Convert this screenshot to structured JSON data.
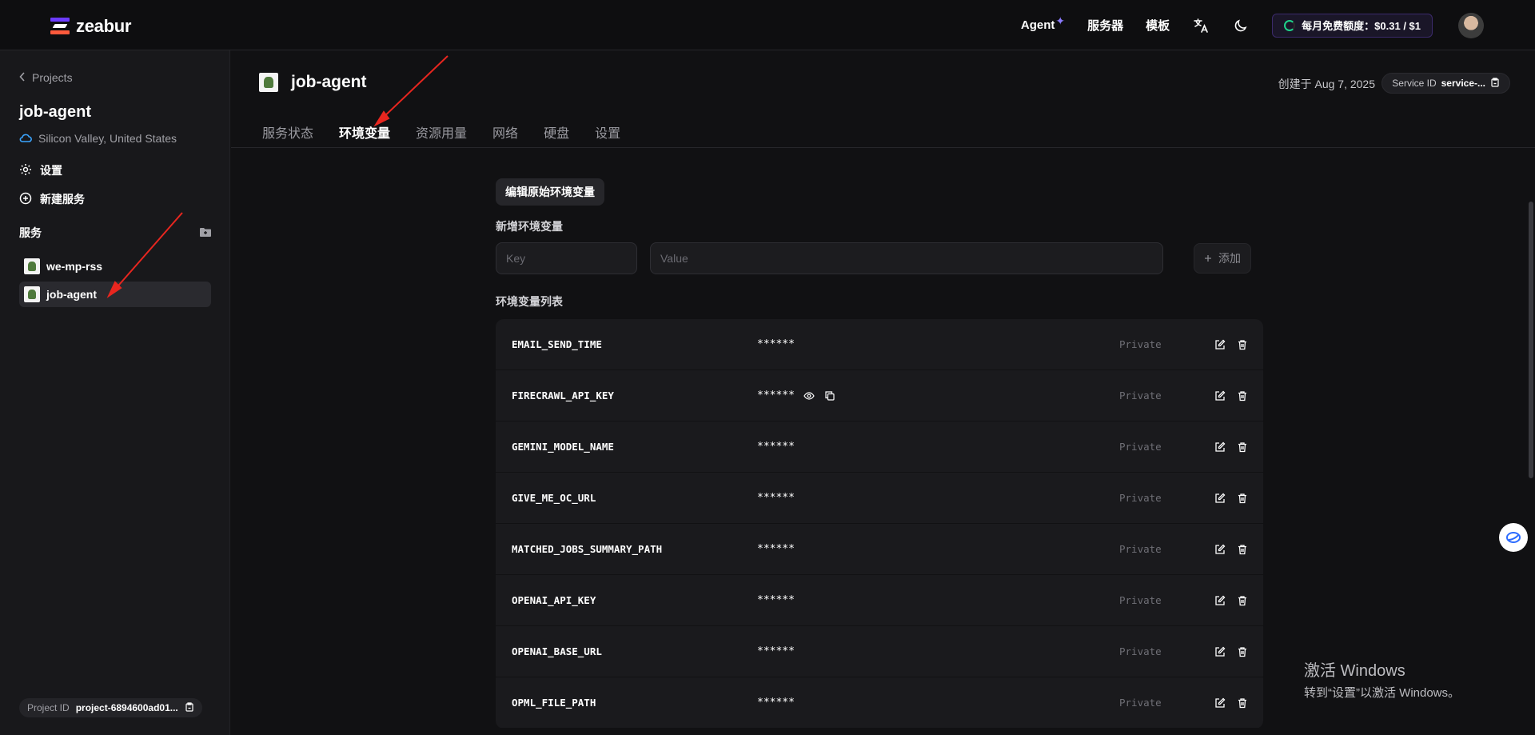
{
  "header": {
    "logo": "zeabur",
    "nav": {
      "agent": "Agent",
      "servers": "服务器",
      "templates": "模板"
    },
    "quota": "每月免费额度：$0.31 / $1"
  },
  "sidebar": {
    "back": "Projects",
    "project_name": "job-agent",
    "region": "Silicon Valley, United States",
    "settings": "设置",
    "new_service": "新建服务",
    "services_heading": "服务",
    "services": [
      {
        "name": "we-mp-rss"
      },
      {
        "name": "job-agent"
      }
    ],
    "project_id_label": "Project ID",
    "project_id": "project-6894600ad01..."
  },
  "service": {
    "name": "job-agent",
    "created": "创建于 Aug 7, 2025",
    "service_id_label": "Service ID",
    "service_id": "service-..."
  },
  "tabs": [
    "服务状态",
    "环境变量",
    "资源用量",
    "网络",
    "硬盘",
    "设置"
  ],
  "env": {
    "edit_raw": "编辑原始环境变量",
    "new_label": "新增环境变量",
    "key_placeholder": "Key",
    "value_placeholder": "Value",
    "add": "添加",
    "list_label": "环境变量列表",
    "rows": [
      {
        "key": "EMAIL_SEND_TIME",
        "value": "******",
        "visibility": "Private"
      },
      {
        "key": "FIRECRAWL_API_KEY",
        "value": "******",
        "visibility": "Private"
      },
      {
        "key": "GEMINI_MODEL_NAME",
        "value": "******",
        "visibility": "Private"
      },
      {
        "key": "GIVE_ME_OC_URL",
        "value": "******",
        "visibility": "Private"
      },
      {
        "key": "MATCHED_JOBS_SUMMARY_PATH",
        "value": "******",
        "visibility": "Private"
      },
      {
        "key": "OPENAI_API_KEY",
        "value": "******",
        "visibility": "Private"
      },
      {
        "key": "OPENAI_BASE_URL",
        "value": "******",
        "visibility": "Private"
      },
      {
        "key": "OPML_FILE_PATH",
        "value": "******",
        "visibility": "Private"
      }
    ]
  },
  "watermark": {
    "line1": "激活 Windows",
    "line2": "转到“设置”以激活 Windows。"
  }
}
